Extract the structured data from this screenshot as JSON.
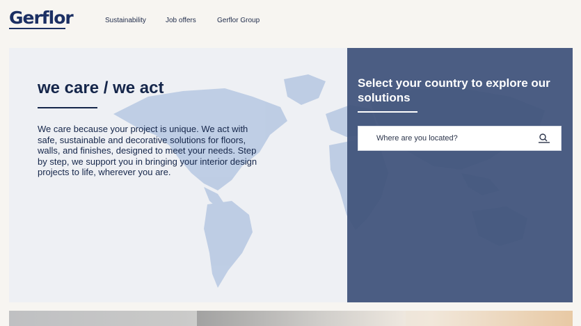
{
  "header": {
    "logo_text": "Gerflor",
    "nav": [
      {
        "label": "Sustainability"
      },
      {
        "label": "Job offers"
      },
      {
        "label": "Gerflor Group"
      }
    ]
  },
  "hero": {
    "title": "we care / we act",
    "body": "We care because your project is unique. We act with safe, sustainable and decorative solutions for floors, walls, and finishes, designed to meet your needs. Step by step, we support you in bringing your interior design projects to life, wherever you are."
  },
  "country_panel": {
    "title": "Select your country to explore our solutions",
    "search_placeholder": "Where are you located?",
    "search_icon": "search-icon"
  },
  "colors": {
    "brand": "#1b2f63",
    "panel": "#3e527a",
    "map": "#a9bfdc"
  }
}
